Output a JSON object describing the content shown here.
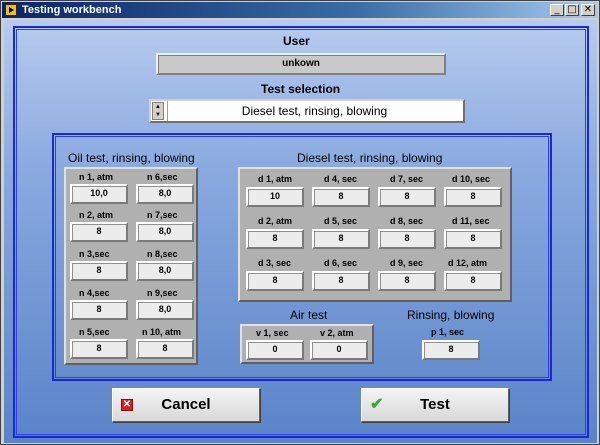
{
  "window": {
    "title": "Testing workbench",
    "min": "_",
    "max": "□",
    "close": "✕"
  },
  "user": {
    "heading": "User",
    "value": "unkown"
  },
  "test_selection": {
    "heading": "Test selection",
    "value": "Diesel test, rinsing, blowing"
  },
  "oil": {
    "heading": "Oil test, rinsing, blowing",
    "fields": [
      {
        "label": "n 1, atm",
        "value": "10,0"
      },
      {
        "label": "n 6,sec",
        "value": "8,0"
      },
      {
        "label": "n 2, atm",
        "value": "8"
      },
      {
        "label": "n 7,sec",
        "value": "8,0"
      },
      {
        "label": "n 3,sec",
        "value": "8"
      },
      {
        "label": "n 8,sec",
        "value": "8,0"
      },
      {
        "label": "n 4,sec",
        "value": "8"
      },
      {
        "label": "n 9,sec",
        "value": "8,0"
      },
      {
        "label": "n 5,sec",
        "value": "8"
      },
      {
        "label": "n 10, atm",
        "value": "8"
      }
    ]
  },
  "diesel": {
    "heading": "Diesel test, rinsing, blowing",
    "fields": [
      {
        "label": "d 1, atm",
        "value": "10"
      },
      {
        "label": "d 4, sec",
        "value": "8"
      },
      {
        "label": "d 7, sec",
        "value": "8"
      },
      {
        "label": "d 10, sec",
        "value": "8"
      },
      {
        "label": "d 2, atm",
        "value": "8"
      },
      {
        "label": "d 5, sec",
        "value": "8"
      },
      {
        "label": "d 8, sec",
        "value": "8"
      },
      {
        "label": "d 11, sec",
        "value": "8"
      },
      {
        "label": "d 3, sec",
        "value": "8"
      },
      {
        "label": "d 6, sec",
        "value": "8"
      },
      {
        "label": "d 9, sec",
        "value": "8"
      },
      {
        "label": "d 12, atm",
        "value": "8"
      }
    ]
  },
  "air": {
    "heading": "Air test",
    "fields": [
      {
        "label": "v 1, sec",
        "value": "0"
      },
      {
        "label": "v 2, atm",
        "value": "0"
      }
    ]
  },
  "rinsing": {
    "heading": "Rinsing, blowing",
    "fields": [
      {
        "label": "p 1, sec",
        "value": "8"
      }
    ]
  },
  "buttons": {
    "cancel": {
      "label": "Cancel",
      "icon": "cancel-icon"
    },
    "test": {
      "label": "Test",
      "icon": "checkmark-icon"
    }
  }
}
